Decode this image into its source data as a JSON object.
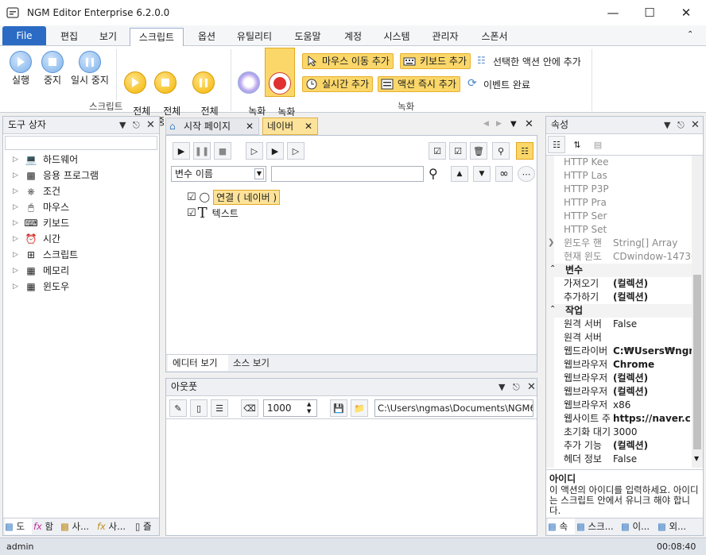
{
  "window": {
    "title": "NGM Editor   Enterprise 6.2.0.0"
  },
  "menu_tabs": [
    "File",
    "편집",
    "보기",
    "스크립트",
    "옵션",
    "유틸리티",
    "도움말",
    "계정",
    "시스템",
    "관리자",
    "스폰서"
  ],
  "ribbon": {
    "script": {
      "run": "실행",
      "stop": "중지",
      "pause": "일시 중지",
      "run_all": "전체\n실행",
      "stop_all": "전체\n중지",
      "pause_all": "전체\n일시 중지",
      "group": "스크립트"
    },
    "record": {
      "start": "녹화\n시작",
      "stop": "녹화\n중지",
      "mouse_move": "마우스 이동 추가",
      "keyboard": "키보드 추가",
      "add_in_selected": "선택한 액션 안에 추가",
      "realtime": "실시간 추가",
      "instant": "액션 즉시 추가",
      "event_done": "이벤트 완료",
      "group": "녹화"
    }
  },
  "toolbox": {
    "title": "도구 상자",
    "items": [
      "하드웨어",
      "응용 프로그램",
      "조건",
      "마우스",
      "키보드",
      "시간",
      "스크립트",
      "메모리",
      "윈도우"
    ],
    "bottom_tabs": [
      "도",
      "함",
      "사...",
      "사...",
      "즐"
    ]
  },
  "editor": {
    "tabs": [
      "시작 페이지",
      "네이버"
    ],
    "var_name": "변수 이름",
    "search_value": "",
    "nodes": [
      "연결 ( 네이버 )",
      "텍스트"
    ],
    "view_tabs": [
      "에디터 보기",
      "소스 보기"
    ]
  },
  "output": {
    "title": "아웃풋",
    "count": "1000",
    "path": "C:\\Users\\ngmas\\Documents\\NGM6\\"
  },
  "properties": {
    "title": "속성",
    "rows": [
      {
        "n": "HTTP Kee",
        "v": "",
        "g": true
      },
      {
        "n": "HTTP Las",
        "v": "",
        "g": true
      },
      {
        "n": "HTTP P3P",
        "v": "",
        "g": true
      },
      {
        "n": "HTTP Pra",
        "v": "",
        "g": true
      },
      {
        "n": "HTTP Ser",
        "v": "",
        "g": true
      },
      {
        "n": "HTTP Set",
        "v": "",
        "g": true
      },
      {
        "n": "윈도우 핸",
        "v": "String[] Array",
        "g": true
      },
      {
        "n": "현재 윈도",
        "v": "CDwindow-14730",
        "g": true
      }
    ],
    "cat_var": "변수",
    "var_rows": [
      {
        "n": "가져오기",
        "v": "(컬렉션)"
      },
      {
        "n": "추가하기",
        "v": "(컬렉션)"
      }
    ],
    "cat_job": "작업",
    "job_rows": [
      {
        "n": "원격 서버",
        "v": "False"
      },
      {
        "n": "원격 서버",
        "v": ""
      },
      {
        "n": "웹드라이버",
        "v": "C:₩Users₩ngm"
      },
      {
        "n": "웹브라우저",
        "v": "Chrome"
      },
      {
        "n": "웹브라우저",
        "v": "(컬렉션)"
      },
      {
        "n": "웹브라우저",
        "v": "(컬렉션)"
      },
      {
        "n": "웹브라우저",
        "v": "x86"
      },
      {
        "n": "웹사이트 주",
        "v": "https://naver.c"
      },
      {
        "n": "초기화 대기",
        "v": "3000"
      },
      {
        "n": "추가 기능",
        "v": "(컬렉션)"
      },
      {
        "n": "헤더 정보",
        "v": "False"
      }
    ],
    "desc_title": "아이디",
    "desc_text": "이 액션의 아이디를 입력하세요. 아이디는 스크립트 안에서 유니크 해야 합니다.",
    "bottom_tabs": [
      "속",
      "스크...",
      "이...",
      "외..."
    ]
  },
  "status": {
    "user": "admin",
    "time": "00:08:40"
  }
}
